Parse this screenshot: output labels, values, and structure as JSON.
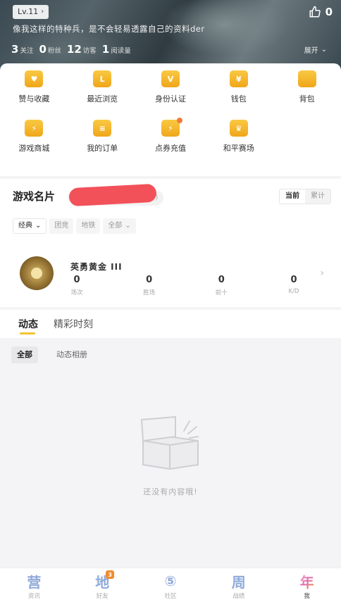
{
  "header": {
    "level": "Lv.11",
    "likes": "0",
    "signature": "像我这样的特种兵，是不会轻易透露自己的资料der",
    "stats": [
      {
        "num": "3",
        "label": "关注"
      },
      {
        "num": "0",
        "label": "粉丝"
      },
      {
        "num": "12",
        "label": "访客"
      },
      {
        "num": "1",
        "label": "阅读量"
      }
    ],
    "expand_label": "展开"
  },
  "grid": [
    {
      "label": "赞与收藏",
      "icon": "heart-icon",
      "glyph": "♥"
    },
    {
      "label": "最近浏览",
      "icon": "history-icon",
      "glyph": "L"
    },
    {
      "label": "身份认证",
      "icon": "verify-icon",
      "glyph": "V"
    },
    {
      "label": "钱包",
      "icon": "wallet-icon",
      "glyph": "¥"
    },
    {
      "label": "背包",
      "icon": "backpack-icon",
      "glyph": ""
    },
    {
      "label": "游戏商城",
      "icon": "shop-icon",
      "glyph": "⚡"
    },
    {
      "label": "我的订单",
      "icon": "order-icon",
      "glyph": "≡"
    },
    {
      "label": "点券充值",
      "icon": "coupon-icon",
      "glyph": "⚡"
    },
    {
      "label": "和平赛场",
      "icon": "trophy-icon",
      "glyph": "♛"
    }
  ],
  "namecard": {
    "title": "游戏名片",
    "tag_tail": "0)",
    "toggle": [
      "当前",
      "累计"
    ],
    "filters": [
      "经典",
      "团竞",
      "地铁",
      "全部"
    ],
    "rank_name": "英勇黄金 III",
    "rank_stats": [
      {
        "value": "0",
        "label": "场次"
      },
      {
        "value": "0",
        "label": "胜场"
      },
      {
        "value": "0",
        "label": "前十"
      },
      {
        "value": "0",
        "label": "K/D"
      }
    ]
  },
  "feed": {
    "tabs": [
      "动态",
      "精彩时刻"
    ],
    "subtabs": [
      "全部",
      "动态相册"
    ],
    "empty_text": "还没有内容哦!"
  },
  "nav": [
    {
      "label": "资讯",
      "glyph": "营"
    },
    {
      "label": "好友",
      "glyph": "地",
      "badge": "3"
    },
    {
      "label": "社区",
      "glyph": "⑤"
    },
    {
      "label": "战绩",
      "glyph": "周"
    },
    {
      "label": "我",
      "glyph": "年"
    }
  ]
}
